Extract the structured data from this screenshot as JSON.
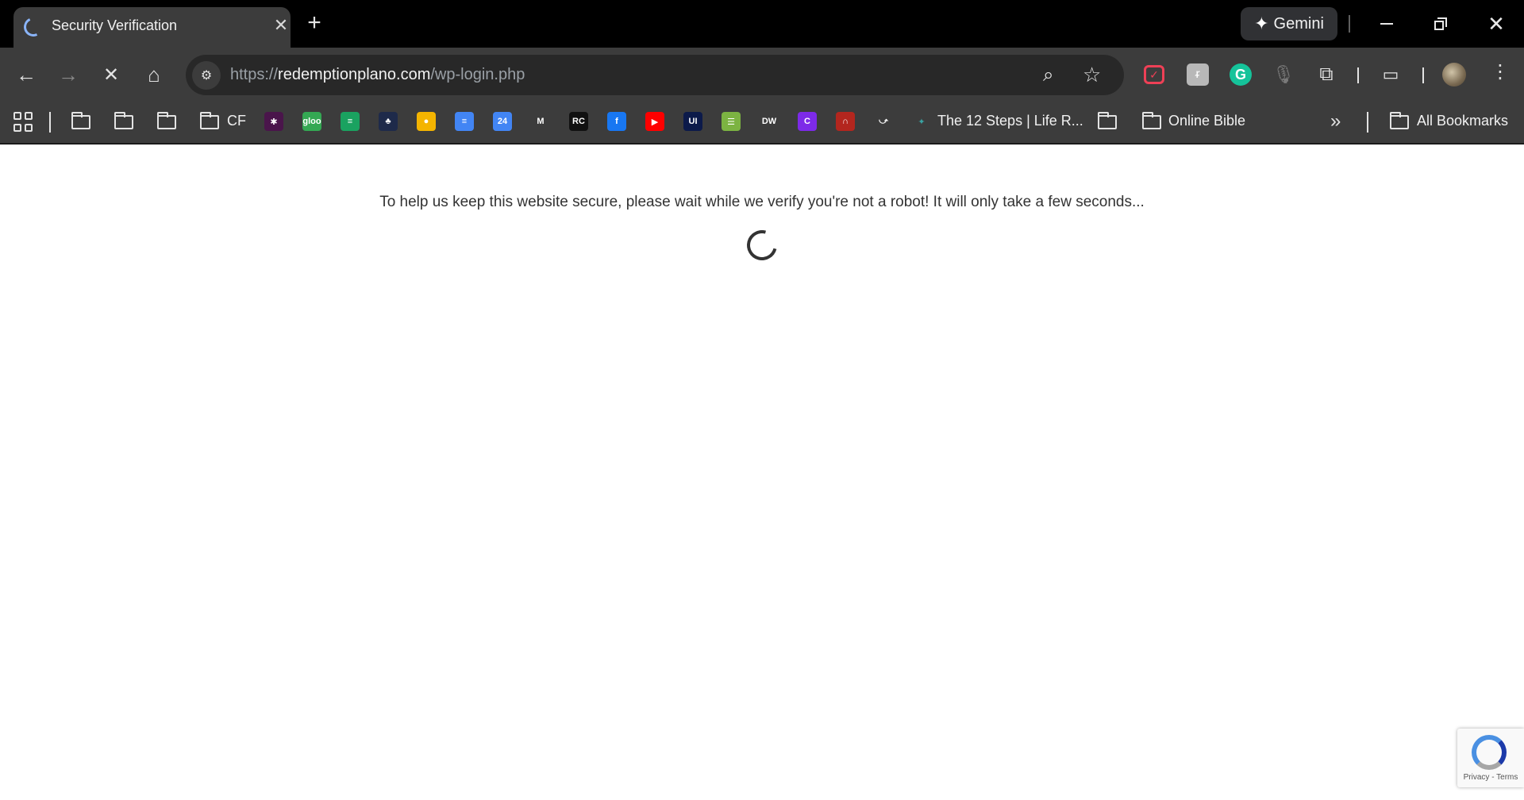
{
  "tab": {
    "title": "Security Verification",
    "close": "✕"
  },
  "newtab": "+",
  "gemini": {
    "label": "Gemini",
    "icon": "✦"
  },
  "window": {
    "close": "✕"
  },
  "nav": {
    "back": "←",
    "forward": "→",
    "stop": "✕",
    "home": "⌂"
  },
  "omnibox": {
    "scheme": "https://",
    "host": "redemptionplano.com",
    "path": "/wp-login.php",
    "zoom_icon": "zoom-out-icon",
    "star_icon": "☆"
  },
  "extensions": [
    "pocket-icon",
    "cat-extension-icon",
    "grammarly-icon",
    "microphone-icon",
    "puzzle-icon",
    "cast-search-icon"
  ],
  "bookmarks": {
    "folder_cf": "CF",
    "steps": "The 12 Steps | Life R...",
    "online_bible": "Online Bible",
    "all": "All Bookmarks",
    "overflow": "»",
    "favicons": [
      {
        "name": "slack-icon",
        "color": "#4a154b",
        "glyph": "✱"
      },
      {
        "name": "gloo-icon",
        "color": "#34a853",
        "glyph": "gloo"
      },
      {
        "name": "sheet-icon",
        "color": "#1aa260",
        "glyph": "≡"
      },
      {
        "name": "tree-icon",
        "color": "#1e2a4a",
        "glyph": "♣"
      },
      {
        "name": "keep-icon",
        "color": "#f4b400",
        "glyph": "●"
      },
      {
        "name": "docs-icon",
        "color": "#4285f4",
        "glyph": "≡"
      },
      {
        "name": "calendar-icon",
        "color": "#4285f4",
        "glyph": "24"
      },
      {
        "name": "gmail-icon",
        "color": "#3c3c3c",
        "glyph": "M"
      },
      {
        "name": "rc-icon",
        "color": "#111111",
        "glyph": "RC"
      },
      {
        "name": "facebook-icon",
        "color": "#1877f2",
        "glyph": "f"
      },
      {
        "name": "youtube-icon",
        "color": "#ff0000",
        "glyph": "▶"
      },
      {
        "name": "ui-icon",
        "color": "#0c1a4a",
        "glyph": "UI"
      },
      {
        "name": "list-icon",
        "color": "#7cb342",
        "glyph": "☰"
      },
      {
        "name": "dw-icon",
        "color": "#3c3c3c",
        "glyph": "DW"
      },
      {
        "name": "canva-icon",
        "color": "#7d2ae8",
        "glyph": "C"
      },
      {
        "name": "headphones-icon",
        "color": "#b3261e",
        "glyph": "∩"
      },
      {
        "name": "red-app-icon",
        "color": "#3c3c3c",
        "glyph": "⤻"
      }
    ]
  },
  "page": {
    "message": "To help us keep this website secure, please wait while we verify you're not a robot! It will only take a few seconds...",
    "recaptcha_links": "Privacy - Terms"
  }
}
